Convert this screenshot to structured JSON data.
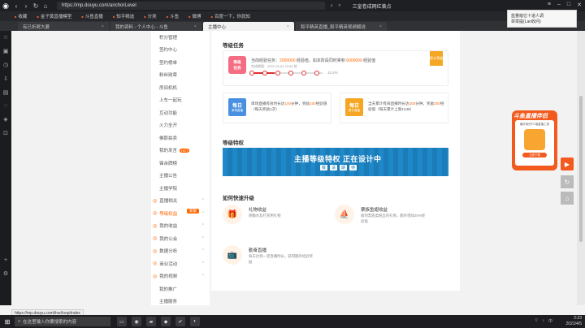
{
  "browser": {
    "url": "https://mp.douyu.com/anchorLevel",
    "page_title": "三皇卷成网红黄点",
    "bookmarks": [
      "收藏",
      "金子黄直播模型",
      "斗鱼直播",
      "知乎精选",
      "分类",
      "斗鱼",
      "微博",
      "百度一下，你就知"
    ],
    "tabs": [
      {
        "label": "有已折屑大菱",
        "active": false
      },
      {
        "label": "我的资料 - 个人中心 - 斗鱼",
        "active": false
      },
      {
        "label": "主播中心",
        "active": true
      },
      {
        "label": "和平精英直播_和平精英视频解说",
        "active": false
      }
    ],
    "notification": {
      "line1": "蓝量喻亿十道人调",
      "line2": "举举提(Lan收问)"
    }
  },
  "menu": {
    "items": [
      {
        "label": "积分管理",
        "type": "item"
      },
      {
        "label": "签约中心",
        "type": "item"
      },
      {
        "label": "签约榜单",
        "type": "item"
      },
      {
        "label": "粉丝勋章",
        "type": "item"
      },
      {
        "label": "房间机机",
        "type": "item"
      },
      {
        "label": "上车一起玩",
        "type": "item"
      },
      {
        "label": "互动功能",
        "type": "item"
      },
      {
        "label": "火力全开",
        "type": "item"
      },
      {
        "label": "佛那拍卖",
        "type": "item"
      },
      {
        "label": "我的发言",
        "type": "item",
        "hot": "HOT"
      },
      {
        "label": "锋余牌榜",
        "type": "item"
      },
      {
        "label": "主播公告",
        "type": "item"
      },
      {
        "label": "主播学院",
        "type": "item"
      },
      {
        "label": "直播相关",
        "type": "section"
      },
      {
        "label": "等级权益",
        "type": "section",
        "active": true,
        "tag": "新版"
      },
      {
        "label": "我的收益",
        "type": "section"
      },
      {
        "label": "我的公会",
        "type": "section"
      },
      {
        "label": "数据分析",
        "type": "section"
      },
      {
        "label": "商业活动",
        "type": "section"
      },
      {
        "label": "我的视频",
        "type": "section"
      },
      {
        "label": "我的推广",
        "type": "item"
      },
      {
        "label": "主播服务",
        "type": "item"
      }
    ]
  },
  "main": {
    "task_heading": "等级任务",
    "task": {
      "icon_l1": "等级",
      "icon_l2": "任务",
      "desc_pre": "当前经验任务：",
      "cur": "2000000",
      "mid": " 经验值，如本阶段同时累积 ",
      "target": "6000000",
      "suf": " 经验值",
      "date": "完成期限：2021-05-04 23:59 前",
      "progress_label": "33.2%",
      "progress": 0.332,
      "badge": "第五等级"
    },
    "daily": [
      {
        "icon_main": "每日",
        "icon_sub": "单场直播",
        "text_pre": "单场直播有效时长达",
        "v1": "100",
        "text_mid": "分钟，奖励",
        "v2": "100",
        "text_suf": "经验值（每天奖励1次）",
        "color": "#4a90e2"
      },
      {
        "icon_main": "每日",
        "icon_sub": "累计直播",
        "text_pre": "当天累计有效直播时长达",
        "v1": "300",
        "text_mid": "分钟，奖励",
        "v2": "300",
        "text_suf": "经验值（每天累计上限1248）",
        "color": "#f5a623"
      }
    ],
    "priv_heading": "等级特权",
    "banner": {
      "title": "主播等级特权",
      "title2": "正在设计中",
      "sub": [
        "敬",
        "请",
        "期",
        "待"
      ]
    },
    "how_heading": "如何快速升级",
    "how": [
      {
        "title": "礼物收益",
        "desc": "明确水友打赏用礼物",
        "icon": "gift-icon",
        "glyph": "🎁"
      },
      {
        "title": "票族鱼翅收益",
        "desc": "收到票族类粉丝的礼物，额外增加20%经验值",
        "icon": "boat-icon",
        "glyph": "⛵"
      },
      {
        "title": "勤奋直播",
        "desc": "每天达到一定直播时长，获得额外经验奖励",
        "icon": "tv-icon",
        "glyph": "📺"
      }
    ]
  },
  "promo": {
    "title": "斗鱼直播伴侣",
    "sub": "最好用的PC端直播工具",
    "btn": "立即下载"
  },
  "status_url": "https://mp.douyu.com/live/loop/index",
  "taskbar": {
    "search": "在这里输入你要搜索的内容",
    "time": "2:23",
    "date": "2021/4/5",
    "lang": "中"
  }
}
